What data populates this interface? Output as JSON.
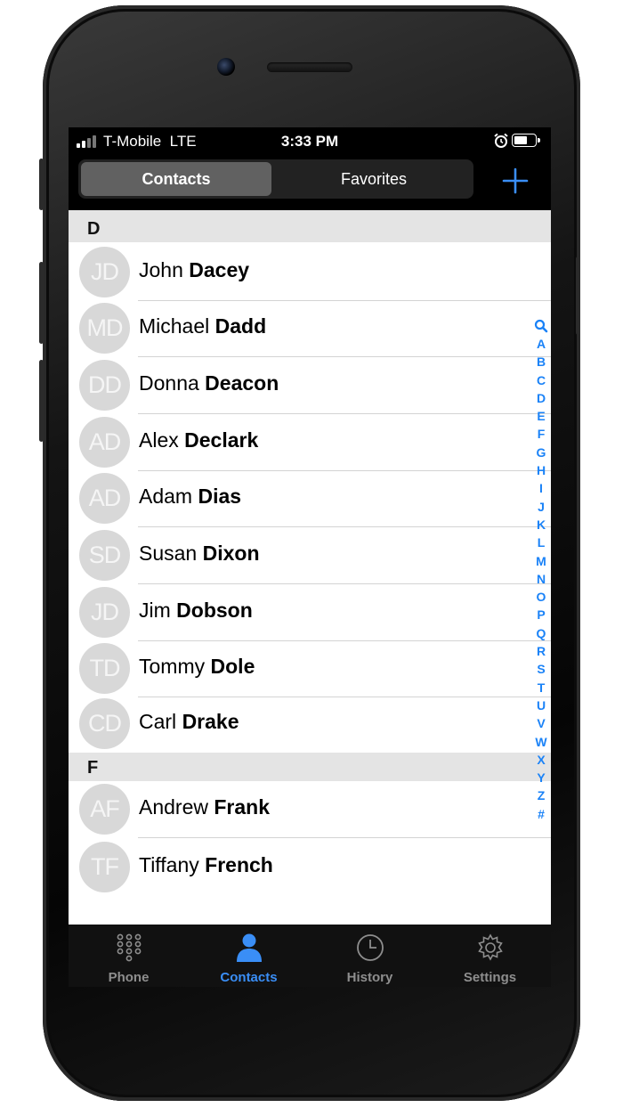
{
  "status_bar": {
    "carrier": "T-Mobile  LTE",
    "time": "3:33 PM"
  },
  "nav": {
    "segments": [
      "Contacts",
      "Favorites"
    ],
    "selected_segment": "Contacts"
  },
  "sections": [
    {
      "letter": "D",
      "contacts": [
        {
          "initials": "JD",
          "first": "John",
          "last": "Dacey"
        },
        {
          "initials": "MD",
          "first": "Michael",
          "last": "Dadd"
        },
        {
          "initials": "DD",
          "first": "Donna",
          "last": "Deacon"
        },
        {
          "initials": "AD",
          "first": "Alex",
          "last": "Declark"
        },
        {
          "initials": "AD",
          "first": "Adam",
          "last": "Dias"
        },
        {
          "initials": "SD",
          "first": "Susan",
          "last": "Dixon"
        },
        {
          "initials": "JD",
          "first": "Jim",
          "last": "Dobson"
        },
        {
          "initials": "TD",
          "first": "Tommy",
          "last": "Dole"
        },
        {
          "initials": "CD",
          "first": "Carl",
          "last": "Drake"
        }
      ]
    },
    {
      "letter": "F",
      "contacts": [
        {
          "initials": "AF",
          "first": "Andrew",
          "last": "Frank"
        },
        {
          "initials": "TF",
          "first": "Tiffany",
          "last": "French"
        }
      ]
    }
  ],
  "index_letters": [
    "A",
    "B",
    "C",
    "D",
    "E",
    "F",
    "G",
    "H",
    "I",
    "J",
    "K",
    "L",
    "M",
    "N",
    "O",
    "P",
    "Q",
    "R",
    "S",
    "T",
    "U",
    "V",
    "W",
    "X",
    "Y",
    "Z",
    "#"
  ],
  "tabs": [
    {
      "label": "Phone",
      "icon": "keypad-icon",
      "active": false
    },
    {
      "label": "Contacts",
      "icon": "person-icon",
      "active": true
    },
    {
      "label": "History",
      "icon": "clock-icon",
      "active": false
    },
    {
      "label": "Settings",
      "icon": "gear-icon",
      "active": false
    }
  ],
  "colors": {
    "accent": "#3a8ef6",
    "index": "#1a82f7",
    "section_header": "#e4e4e4",
    "avatar": "#d8d8d8",
    "bar_background": "#000000"
  }
}
